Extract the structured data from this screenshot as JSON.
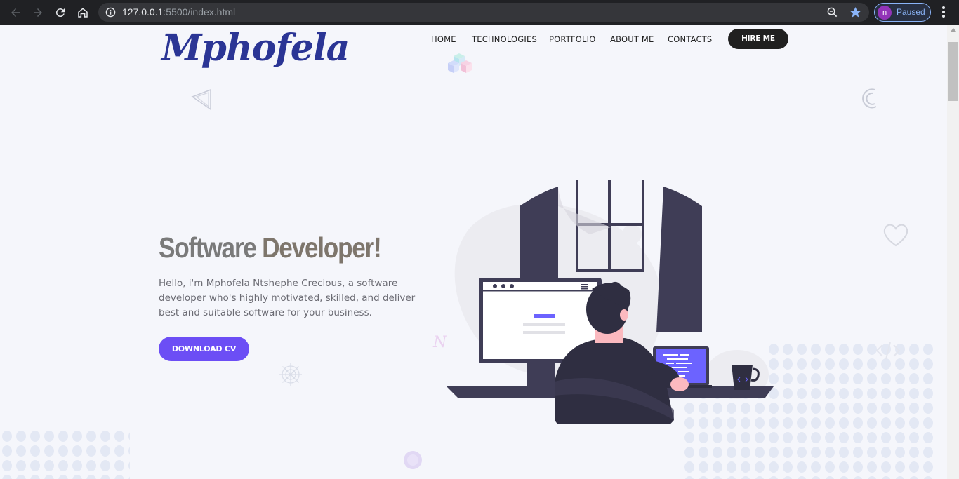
{
  "browser": {
    "url_host": "127.0.0.1",
    "url_rest": ":5500/index.html",
    "profile_initial": "n",
    "profile_status": "Paused",
    "icons": [
      "back-arrow-icon",
      "forward-arrow-icon",
      "reload-icon",
      "home-icon",
      "info-icon",
      "zoom-icon",
      "star-icon",
      "kebab-menu-icon"
    ]
  },
  "site": {
    "logo_text": "Mphofela",
    "nav": [
      "HOME",
      "TECHNOLOGIES",
      "PORTFOLIO",
      "ABOUT ME",
      "CONTACTS"
    ],
    "hire_label": "HIRE ME"
  },
  "hero": {
    "title_part1": "Software",
    "title_part2": " Developer!",
    "description": "Hello, i'm Mphofela Ntshephe Crecious, a software developer who's highly motivated, skilled, and deliver best and suitable software for your business.",
    "button_label": "DOWNLOAD CV",
    "floating_letter": "N"
  },
  "colors": {
    "accent": "#6c4ef5",
    "logo": "#2b3595",
    "dark": "#3f3d56",
    "page_bg": "#f5f6fb"
  }
}
